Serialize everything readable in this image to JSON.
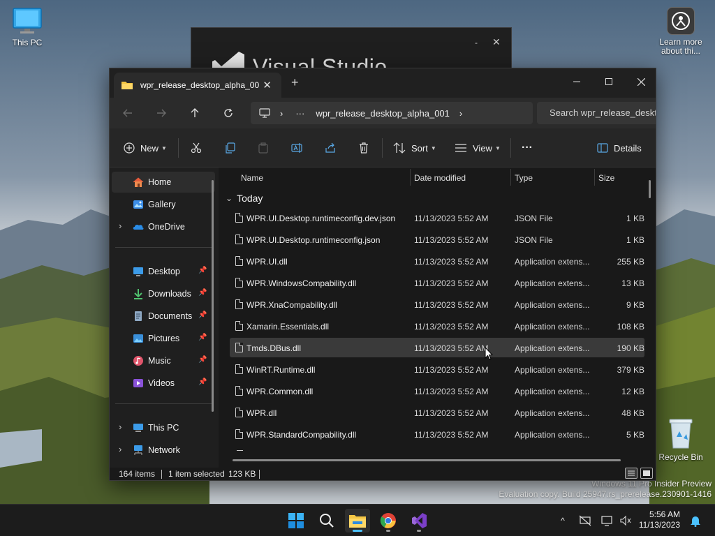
{
  "desktop": {
    "icons": [
      {
        "label": "This PC"
      },
      {
        "label": "Learn more about thi..."
      },
      {
        "label": "Recycle Bin"
      }
    ],
    "watermark": {
      "line1": "Windows 11 Pro Insider Preview",
      "line2": "Evaluation copy. Build 25947.rs_prerelease.230901-1416"
    }
  },
  "visual_studio_splash": {
    "title": "Visual Studio",
    "min_label": "-",
    "close_label": "✕"
  },
  "explorer": {
    "tab": {
      "title": "wpr_release_desktop_alpha_00",
      "close": "✕",
      "new_tab": "+"
    },
    "window_controls": {
      "minimize": "—",
      "maximize": "☐",
      "close": "✕"
    },
    "address": {
      "more": "···",
      "separator": "›",
      "folder": "wpr_release_desktop_alpha_001",
      "trailing_chevron": "›",
      "search_placeholder": "Search wpr_release_deskt"
    },
    "commands": {
      "new_label": "New",
      "sort_label": "Sort",
      "view_label": "View",
      "more_label": "···",
      "details_label": "Details"
    },
    "nav": {
      "home": "Home",
      "gallery": "Gallery",
      "onedrive": "OneDrive",
      "desktop": "Desktop",
      "downloads": "Downloads",
      "documents": "Documents",
      "pictures": "Pictures",
      "music": "Music",
      "videos": "Videos",
      "this_pc": "This PC",
      "network": "Network",
      "expand_glyph": "›",
      "pin_glyph": "📌"
    },
    "columns": {
      "name": "Name",
      "date": "Date modified",
      "type": "Type",
      "size": "Size"
    },
    "group": {
      "label": "Today",
      "chevron": "⌄"
    },
    "files": [
      {
        "name": "WPR.UI.Desktop.runtimeconfig.dev.json",
        "date": "11/13/2023 5:52 AM",
        "type": "JSON File",
        "size": "1 KB"
      },
      {
        "name": "WPR.UI.Desktop.runtimeconfig.json",
        "date": "11/13/2023 5:52 AM",
        "type": "JSON File",
        "size": "1 KB"
      },
      {
        "name": "WPR.UI.dll",
        "date": "11/13/2023 5:52 AM",
        "type": "Application extens...",
        "size": "255 KB"
      },
      {
        "name": "WPR.WindowsCompability.dll",
        "date": "11/13/2023 5:52 AM",
        "type": "Application extens...",
        "size": "13 KB"
      },
      {
        "name": "WPR.XnaCompability.dll",
        "date": "11/13/2023 5:52 AM",
        "type": "Application extens...",
        "size": "9 KB"
      },
      {
        "name": "Xamarin.Essentials.dll",
        "date": "11/13/2023 5:52 AM",
        "type": "Application extens...",
        "size": "108 KB"
      },
      {
        "name": "Tmds.DBus.dll",
        "date": "11/13/2023 5:52 AM",
        "type": "Application extens...",
        "size": "190 KB",
        "selected": true
      },
      {
        "name": "WinRT.Runtime.dll",
        "date": "11/13/2023 5:52 AM",
        "type": "Application extens...",
        "size": "379 KB"
      },
      {
        "name": "WPR.Common.dll",
        "date": "11/13/2023 5:52 AM",
        "type": "Application extens...",
        "size": "12 KB"
      },
      {
        "name": "WPR.dll",
        "date": "11/13/2023 5:52 AM",
        "type": "Application extens...",
        "size": "48 KB"
      },
      {
        "name": "WPR.StandardCompability.dll",
        "date": "11/13/2023 5:52 AM",
        "type": "Application extens...",
        "size": "5 KB"
      }
    ],
    "status": {
      "count": "164 items",
      "selection": "1 item selected",
      "selection_size": "123 KB"
    }
  },
  "taskbar": {
    "apps": [
      "start-icon",
      "search-icon",
      "file-explorer-icon",
      "chrome-icon",
      "visual-studio-icon"
    ],
    "clock": {
      "time": "5:56 AM",
      "date": "11/13/2023"
    },
    "tray_chevron": "^"
  },
  "colors": {
    "accent": "#4cc2ff",
    "explorer_bg": "#191919",
    "selected_row": "#3a3a3a",
    "folder_yellow": "#f4c644"
  }
}
